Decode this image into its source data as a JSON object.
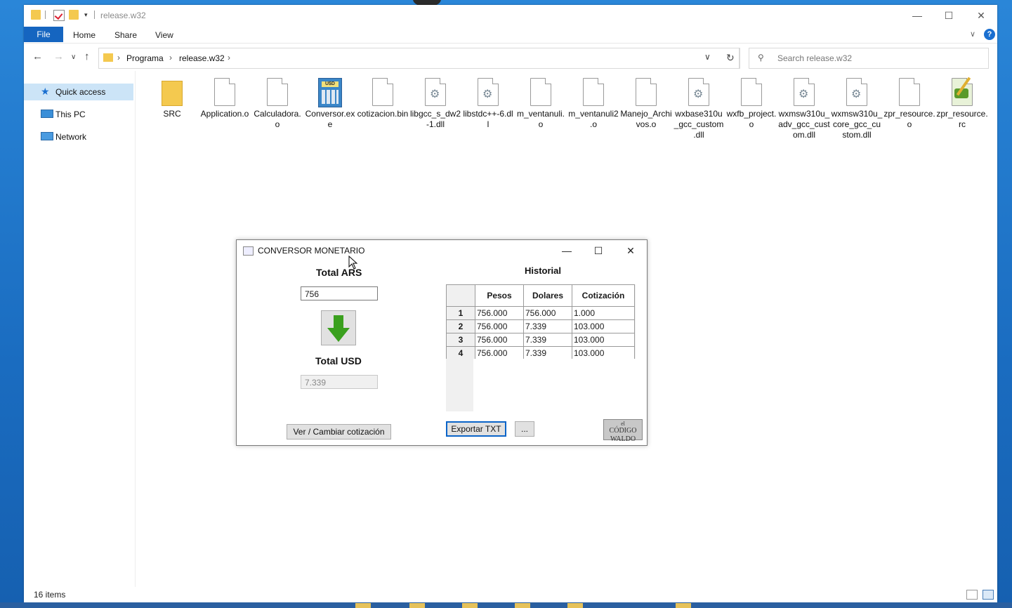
{
  "window": {
    "title": "release.w32",
    "controls": {
      "minimize": "—",
      "maximize": "☐",
      "close": "✕"
    }
  },
  "ribbon": {
    "file": "File",
    "tabs": [
      "Home",
      "Share",
      "View"
    ],
    "help": "?"
  },
  "address": {
    "crumbs": [
      "Programa",
      "release.w32"
    ],
    "search_placeholder": "Search release.w32"
  },
  "nav_pane": {
    "items": [
      {
        "label": "Quick access",
        "icon": "star-icon"
      },
      {
        "label": "This PC",
        "icon": "computer-icon"
      },
      {
        "label": "Network",
        "icon": "network-icon"
      }
    ]
  },
  "files": [
    {
      "name": "SRC",
      "type": "folder"
    },
    {
      "name": "Application.o",
      "type": "doc"
    },
    {
      "name": "Calculadora.o",
      "type": "doc"
    },
    {
      "name": "Conversor.exe",
      "type": "exe"
    },
    {
      "name": "cotizacion.bin",
      "type": "doc"
    },
    {
      "name": "libgcc_s_dw2-1.dll",
      "type": "dll"
    },
    {
      "name": "libstdc++-6.dll",
      "type": "dll"
    },
    {
      "name": "m_ventanuli.o",
      "type": "doc"
    },
    {
      "name": "m_ventanuli2.o",
      "type": "doc"
    },
    {
      "name": "Manejo_Archivos.o",
      "type": "doc"
    },
    {
      "name": "wxbase310u_gcc_custom.dll",
      "type": "dll"
    },
    {
      "name": "wxfb_project.o",
      "type": "doc"
    },
    {
      "name": "wxmsw310u_adv_gcc_custom.dll",
      "type": "dll"
    },
    {
      "name": "wxmsw310u_core_gcc_custom.dll",
      "type": "dll"
    },
    {
      "name": "zpr_resource.o",
      "type": "doc"
    },
    {
      "name": "zpr_resource.rc",
      "type": "rc"
    }
  ],
  "status": {
    "count": "16 items"
  },
  "dialog": {
    "title": "CONVERSOR MONETARIO",
    "total_ars_label": "Total ARS",
    "ars_value": "756",
    "total_usd_label": "Total USD",
    "usd_value": "7.339",
    "change_rate_button": "Ver / Cambiar cotización",
    "historial_label": "Historial",
    "export_button": "Exportar TXT",
    "browse_button": "...",
    "logo_text_top": "el",
    "logo_text_mid": "CÓDIGO",
    "logo_text_bot": "WALDO",
    "table": {
      "headers": [
        "Pesos",
        "Dolares",
        "Cotización"
      ],
      "rows": [
        {
          "n": "1",
          "pesos": "756.000",
          "dolares": "756.000",
          "cotizacion": "1.000"
        },
        {
          "n": "2",
          "pesos": "756.000",
          "dolares": "7.339",
          "cotizacion": "103.000"
        },
        {
          "n": "3",
          "pesos": "756.000",
          "dolares": "7.339",
          "cotizacion": "103.000"
        },
        {
          "n": "4",
          "pesos": "756.000",
          "dolares": "7.339",
          "cotizacion": "103.000"
        }
      ]
    }
  }
}
